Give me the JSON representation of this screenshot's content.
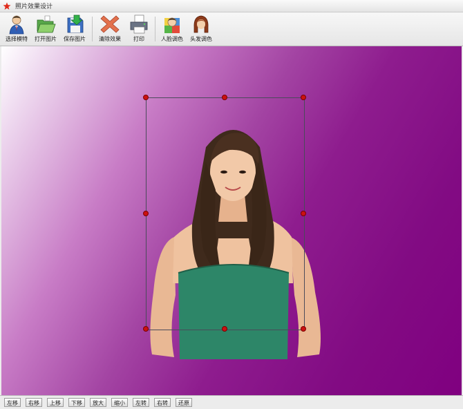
{
  "window": {
    "title": "照片效果设计",
    "icon": "app-star-icon"
  },
  "toolbar": {
    "buttons": [
      {
        "label": "选择模特",
        "icon": "model-person-icon"
      },
      {
        "label": "打开图片",
        "icon": "open-folder-icon"
      },
      {
        "label": "保存图片",
        "icon": "save-disk-icon"
      },
      {
        "label": "清除效果",
        "icon": "clear-x-icon"
      },
      {
        "label": "打印",
        "icon": "printer-icon"
      },
      {
        "label": "人脸调色",
        "icon": "face-color-icon"
      },
      {
        "label": "头发调色",
        "icon": "hair-color-icon"
      }
    ]
  },
  "canvas": {
    "background": {
      "gradient_from": "#ffffff",
      "gradient_to": "#800080"
    },
    "selection_handle_color": "#cc1111",
    "photo_subject": "woman-with-long-brown-hair-green-top"
  },
  "bottom_bar": {
    "buttons": [
      "左移",
      "右移",
      "上移",
      "下移",
      "放大",
      "缩小",
      "左转",
      "右转",
      "还原"
    ]
  }
}
